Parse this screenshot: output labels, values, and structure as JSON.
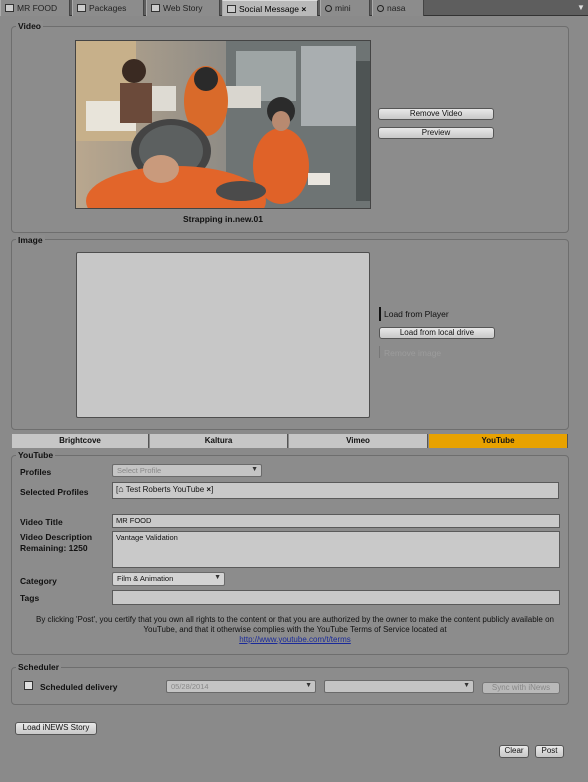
{
  "tabs": [
    {
      "label": "MR FOOD",
      "icon": "grid-icon"
    },
    {
      "label": "Packages",
      "icon": "package-icon"
    },
    {
      "label": "Web Story",
      "icon": "document-icon"
    },
    {
      "label": "Social Message",
      "icon": "social-icon",
      "active": true,
      "close": "×"
    },
    {
      "label": "mini",
      "icon": "search-icon"
    },
    {
      "label": "nasa",
      "icon": "search-icon"
    }
  ],
  "video": {
    "legend": "Video",
    "caption": "Strapping in.new.01",
    "remove_label": "Remove Video",
    "preview_label": "Preview"
  },
  "image": {
    "legend": "Image",
    "load_player": "Load from Player",
    "load_local": "Load from local drive",
    "remove_image": "Remove image"
  },
  "providers": [
    "Brightcove",
    "Kaltura",
    "Vimeo",
    "YouTube"
  ],
  "active_provider": "YouTube",
  "accent": "#e8a200",
  "youtube": {
    "legend": "YouTube",
    "profiles_label": "Profiles",
    "profiles_placeholder": "Select Profile",
    "selected_label": "Selected Profiles",
    "selected_tag": "Test Roberts YouTube",
    "tag_remove": "×",
    "title_label": "Video Title",
    "title_value": "MR FOOD",
    "desc_label_1": "Video Description",
    "desc_label_2": "Remaining: 1250",
    "desc_value": "Vantage Validation",
    "category_label": "Category",
    "category_value": "Film & Animation",
    "tags_label": "Tags",
    "terms_text": "By clicking 'Post', you certify that you own all rights to the content or that you are authorized by the owner to make the content publicly available on YouTube, and that it otherwise complies with the YouTube Terms of Service located at",
    "terms_link": "http://www.youtube.com/t/terms"
  },
  "scheduler": {
    "legend": "Scheduler",
    "checkbox_label": "Scheduled delivery",
    "date_value": "05/28/2014",
    "sync_label": "Sync with iNews"
  },
  "footer": {
    "load_inews": "Load iNEWS Story",
    "clear": "Clear",
    "post": "Post"
  }
}
